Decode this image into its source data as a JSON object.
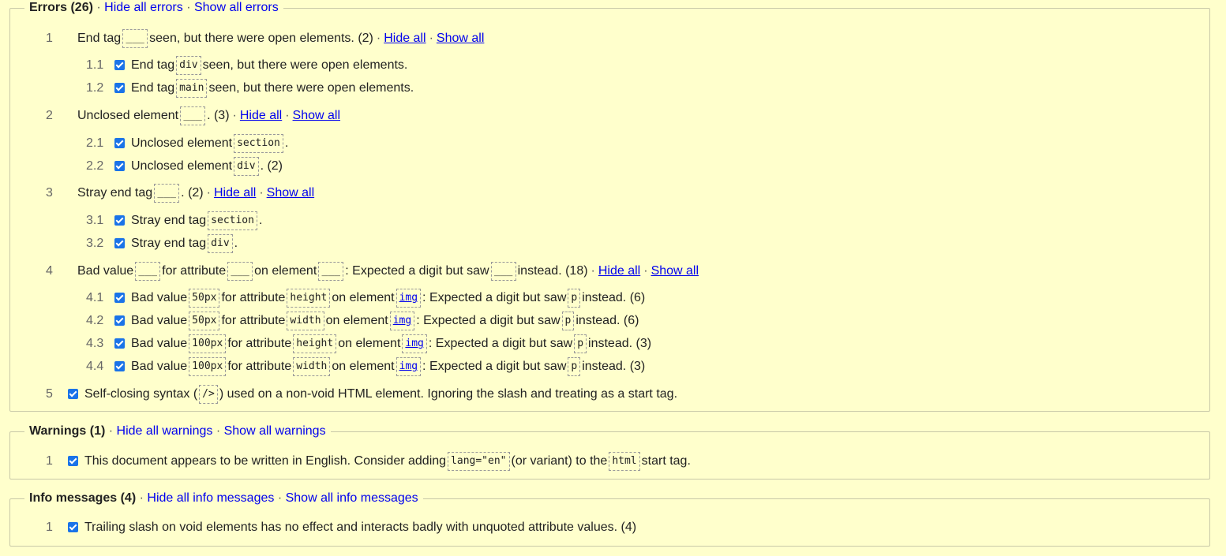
{
  "errors": {
    "title": "Errors (26)",
    "hide_all": "Hide all errors",
    "show_all": "Show all errors",
    "groups": [
      {
        "num": "1",
        "pre": "End tag",
        "post": "seen, but there were open elements. (2)",
        "items": [
          {
            "num": "1.1",
            "pre": "End tag",
            "code": "div",
            "post": "seen, but there were open elements."
          },
          {
            "num": "1.2",
            "pre": "End tag",
            "code": "main",
            "post": "seen, but there were open elements."
          }
        ]
      },
      {
        "num": "2",
        "pre": "Unclosed element",
        "post": ". (3)",
        "items": [
          {
            "num": "2.1",
            "pre": "Unclosed element",
            "code": "section",
            "post": "."
          },
          {
            "num": "2.2",
            "pre": "Unclosed element",
            "code": "div",
            "post": ". (2)"
          }
        ]
      },
      {
        "num": "3",
        "pre": "Stray end tag",
        "post": ". (2)",
        "items": [
          {
            "num": "3.1",
            "pre": "Stray end tag",
            "code": "section",
            "post": "."
          },
          {
            "num": "3.2",
            "pre": "Stray end tag",
            "code": "div",
            "post": "."
          }
        ]
      },
      {
        "num": "4",
        "parts": [
          "Bad value",
          "for attribute",
          "on element",
          ": Expected a digit but saw",
          "instead. (18)"
        ],
        "items": [
          {
            "num": "4.1",
            "value": "50px",
            "attr": "height",
            "el": "img",
            "saw": "p",
            "count": "instead. (6)"
          },
          {
            "num": "4.2",
            "value": "50px",
            "attr": "width",
            "el": "img",
            "saw": "p",
            "count": "instead. (6)"
          },
          {
            "num": "4.3",
            "value": "100px",
            "attr": "height",
            "el": "img",
            "saw": "p",
            "count": "instead. (3)"
          },
          {
            "num": "4.4",
            "value": "100px",
            "attr": "width",
            "el": "img",
            "saw": "p",
            "count": "instead. (3)"
          }
        ]
      }
    ],
    "item5": {
      "num": "5",
      "pre": "Self-closing syntax (",
      "code": "/>",
      "post": ") used on a non-void HTML element. Ignoring the slash and treating as a start tag."
    },
    "group_hide": "Hide all",
    "group_show": "Show all",
    "bad_value_label": "Bad value",
    "for_attribute": "for attribute",
    "on_element": "on element",
    "expected": ": Expected a digit but saw"
  },
  "warnings": {
    "title": "Warnings (1)",
    "hide_all": "Hide all warnings",
    "show_all": "Show all warnings",
    "item": {
      "num": "1",
      "pre": "This document appears to be written in English. Consider adding",
      "code1": "lang=\"en\"",
      "mid": "(or variant) to the",
      "code2": "html",
      "post": "start tag."
    }
  },
  "info": {
    "title": "Info messages (4)",
    "hide_all": "Hide all info messages",
    "show_all": "Show all info messages",
    "item": {
      "num": "1",
      "text": "Trailing slash on void elements has no effect and interacts badly with unquoted attribute values. (4)"
    }
  },
  "separator": "·",
  "colors": {
    "background": "#ffffcc",
    "link": "#0000ee",
    "checkbox": "#1a73e8"
  }
}
